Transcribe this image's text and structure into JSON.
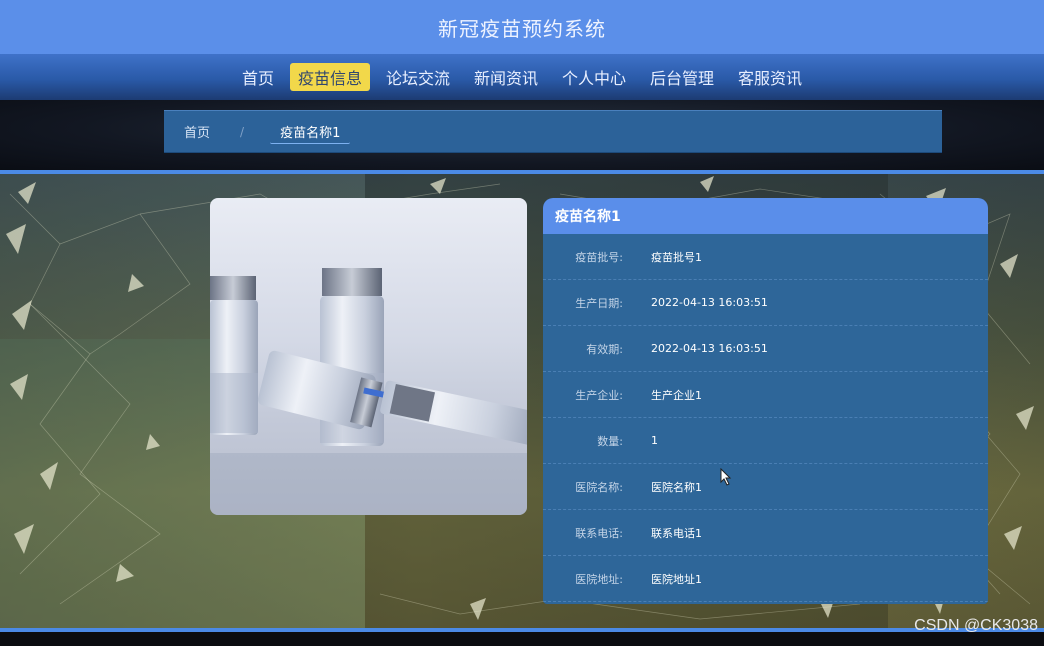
{
  "app": {
    "title": "新冠疫苗预约系统"
  },
  "nav": {
    "items": [
      {
        "label": "首页",
        "active": false
      },
      {
        "label": "疫苗信息",
        "active": true
      },
      {
        "label": "论坛交流",
        "active": false
      },
      {
        "label": "新闻资讯",
        "active": false
      },
      {
        "label": "个人中心",
        "active": false
      },
      {
        "label": "后台管理",
        "active": false
      },
      {
        "label": "客服资讯",
        "active": false
      }
    ]
  },
  "breadcrumb": {
    "home": "首页",
    "separator": "/",
    "current": "疫苗名称1"
  },
  "detail": {
    "title": "疫苗名称1",
    "rows": [
      {
        "label": "疫苗批号:",
        "value": "疫苗批号1"
      },
      {
        "label": "生产日期:",
        "value": "2022-04-13 16:03:51"
      },
      {
        "label": "有效期:",
        "value": "2022-04-13 16:03:51"
      },
      {
        "label": "生产企业:",
        "value": "生产企业1"
      },
      {
        "label": "数量:",
        "value": "1"
      },
      {
        "label": "医院名称:",
        "value": "医院名称1"
      },
      {
        "label": "联系电话:",
        "value": "联系电话1"
      },
      {
        "label": "医院地址:",
        "value": "医院地址1"
      }
    ]
  },
  "image": {
    "subject": "vaccine vials and syringe photo"
  },
  "watermark": "CSDN @CK3038",
  "colors": {
    "topbar": "#5b8fe9",
    "nav_active_bg": "#f2d84a",
    "card_bg": "#2e6699",
    "card_header": "#5a8eea"
  }
}
